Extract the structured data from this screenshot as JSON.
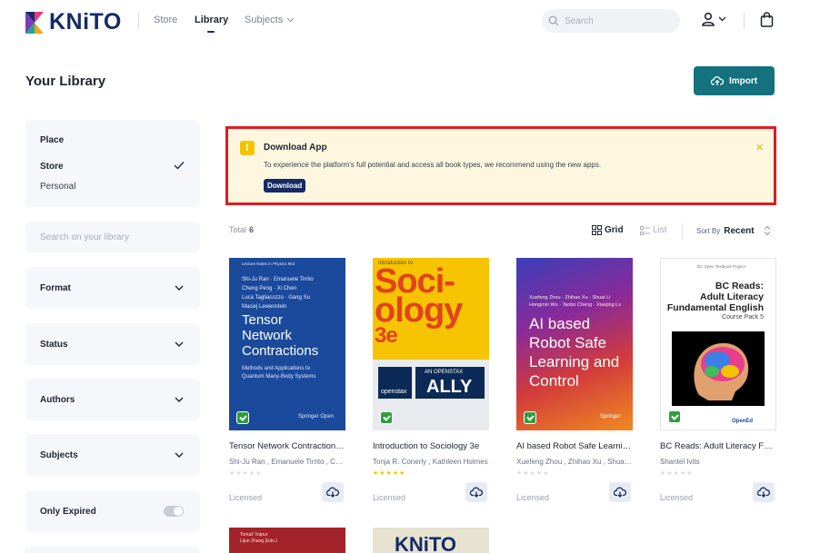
{
  "header": {
    "logo_text": "KNiTO",
    "nav": [
      "Store",
      "Library",
      "Subjects"
    ],
    "search_placeholder": "Search"
  },
  "page_title": "Your Library",
  "import_label": "Import",
  "sidebar": {
    "place_title": "Place",
    "place_options": [
      "Store",
      "Personal"
    ],
    "search_placeholder": "Search on your library",
    "filters": [
      "Format",
      "Status",
      "Authors",
      "Subjects"
    ],
    "only_expired": "Only Expired"
  },
  "banner": {
    "title": "Download App",
    "text": "To experience the platform's full potential and access all book types, we recommend using the new apps.",
    "button": "Download"
  },
  "toolbar": {
    "total_label": "Total",
    "total_count": "6",
    "grid_label": "Grid",
    "list_label": "List",
    "sort_label": "Sort By",
    "sort_value": "Recent"
  },
  "books": [
    {
      "title": "Tensor Network Contractions: Methods and Applications to Quantum Many-Body Systems",
      "authors": "Shi-Ju Ran , Emanuele Tirrito , Cheng Peng , Xi Chen",
      "status": "Licensed",
      "rated": false,
      "cover": {
        "series": "Lecture Notes in Physics  964",
        "authors": [
          "Shi-Ju Ran · Emanuele Tirrito",
          "Cheng Peng · Xi Chen",
          "Luca Tagliacozzo · Gang Su",
          "Maciej Lewenstein"
        ],
        "title_lines": [
          "Tensor",
          "Network",
          "Contractions"
        ],
        "subtitle": [
          "Methods and Applications to",
          "Quantum Many-Body Systems"
        ],
        "publisher": "Springer Open"
      }
    },
    {
      "title": "Introduction to Sociology 3e",
      "authors": "Tonja R. Conerly , Kathleen Holmes",
      "status": "Licensed",
      "rated": true,
      "cover": {
        "top": "Introduction to",
        "title_lines": [
          "Soci-",
          "ology",
          "3e"
        ],
        "brand_small": "AN OPENSTAX",
        "brand_big": "ALLY",
        "brand_logo": "openstax"
      }
    },
    {
      "title": "AI based Robot Safe Learning and Control",
      "authors": "Xuefeng Zhou , Zhihao Xu , Shuai Li",
      "status": "Licensed",
      "rated": false,
      "cover": {
        "authors": [
          "Xuefeng Zhou · Zhihao Xu · Shuai Li",
          "Hongmin Wu · Taobo Cheng · Xiaojing Lv"
        ],
        "title_lines": [
          "AI based",
          "Robot Safe",
          "Learning and",
          "Control"
        ],
        "publisher": "Springer"
      }
    },
    {
      "title": "BC Reads: Adult Literacy Fundamental English",
      "authors": "Shantel Ivits",
      "status": "Licensed",
      "rated": false,
      "cover": {
        "top": "BC Open Textbook Project",
        "title_lines": [
          "BC Reads:",
          "Adult Literacy",
          "Fundamental English"
        ],
        "subtitle": "Course Pack 5",
        "publisher": "OpenEd"
      }
    }
  ],
  "more_books": [
    {
      "cover_text": [
        "Tomaž Vuipur",
        "Lijun Zhang (Eds.)"
      ]
    },
    {
      "cover_text": [
        "KNiTO"
      ]
    }
  ],
  "colors": {
    "accent": "#13727e",
    "brand": "#142b66",
    "banner_bg": "#fdf7df",
    "highlight_border": "#e01b24"
  }
}
